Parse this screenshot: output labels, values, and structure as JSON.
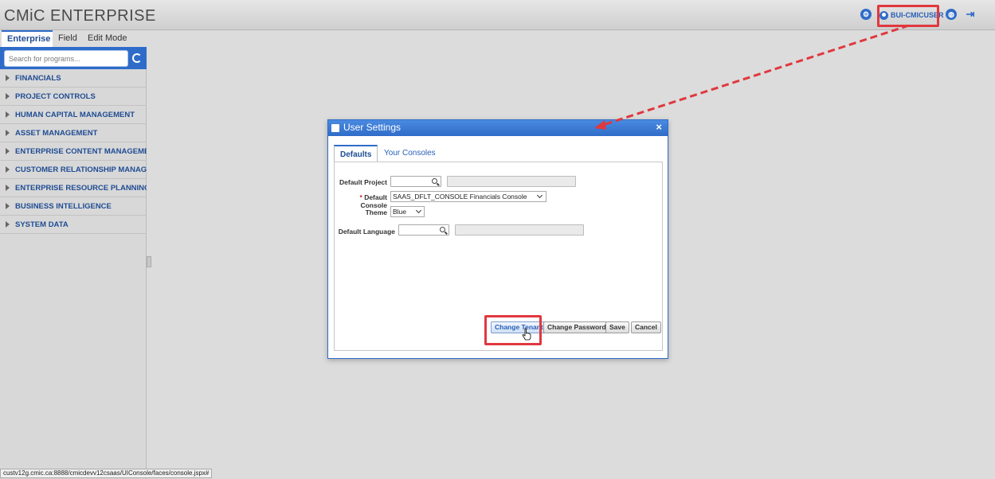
{
  "header": {
    "app_title": "CMiC ENTERPRISE",
    "user_label": "BUI-CMICUSER",
    "icons": [
      "settings-icon",
      "user-icon",
      "globe-icon",
      "logout-icon"
    ]
  },
  "tabs": [
    "Enterprise",
    "Field",
    "Edit Mode"
  ],
  "sidebar": {
    "search_placeholder": "Search for programs...",
    "items": [
      "FINANCIALS",
      "PROJECT CONTROLS",
      "HUMAN CAPITAL MANAGEMENT",
      "ASSET MANAGEMENT",
      "ENTERPRISE CONTENT MANAGEMENT",
      "CUSTOMER RELATIONSHIP MANAGEMENT",
      "ENTERPRISE RESOURCE PLANNING",
      "BUSINESS INTELLIGENCE",
      "SYSTEM DATA"
    ]
  },
  "dialog": {
    "title": "User Settings",
    "close": "×",
    "tabs": [
      "Defaults",
      "Your Consoles"
    ],
    "fields": {
      "default_project_label": "Default Project",
      "default_console_required": "*",
      "default_console_label": "Default Console",
      "default_console_value": "SAAS_DFLT_CONSOLE Financials Console",
      "theme_label": "Theme",
      "theme_value": "Blue",
      "default_language_label": "Default Language"
    },
    "buttons": {
      "change_tenant": "Change Tenant",
      "change_password": "Change Password",
      "save": "Save",
      "cancel": "Cancel"
    }
  },
  "statusbar": {
    "url": "custv12g.cmic.ca:8888/cmicdevv12csaas/UIConsole/faces/console.jspx#"
  },
  "colors": {
    "accent": "#2f6cc9",
    "highlight": "#e0383e"
  }
}
